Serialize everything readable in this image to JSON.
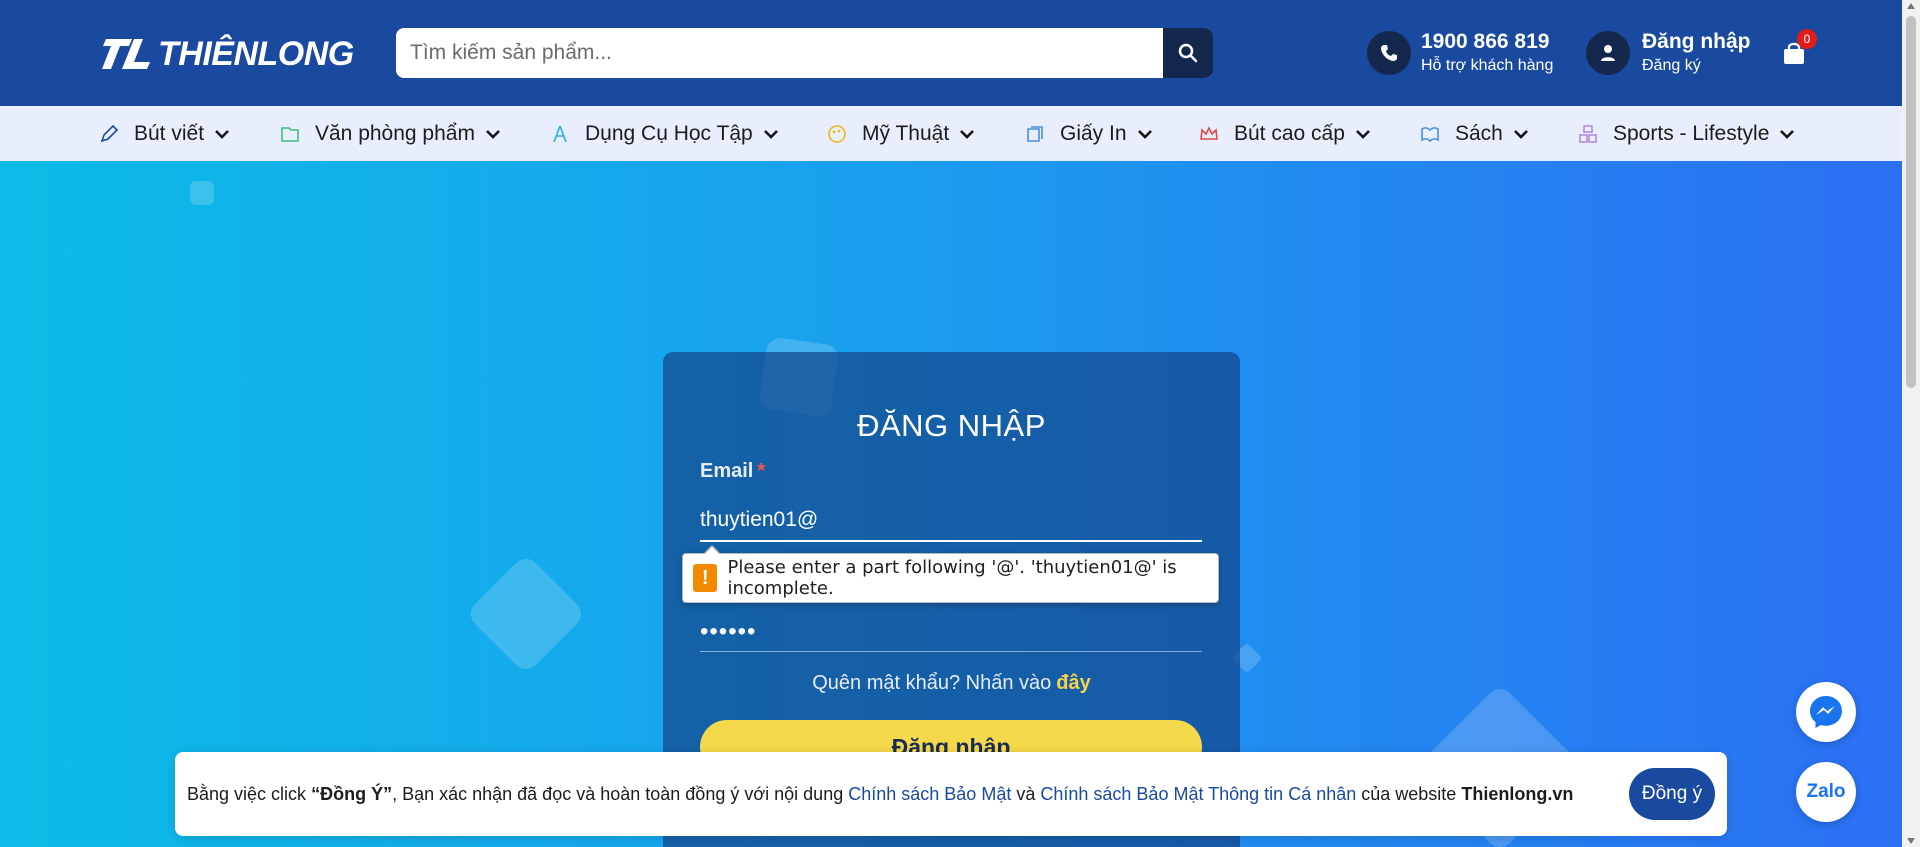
{
  "brand": {
    "logo_text": "THIÊNLONG"
  },
  "search": {
    "placeholder": "Tìm kiếm sản phẩm..."
  },
  "hotline": {
    "number": "1900 866 819",
    "label": "Hỗ trợ khách hàng"
  },
  "account": {
    "login": "Đăng nhập",
    "register": "Đăng ký"
  },
  "cart": {
    "count": "0"
  },
  "nav": [
    {
      "label": "Bút viết",
      "icon": "pen-icon"
    },
    {
      "label": "Văn phòng phẩm",
      "icon": "folder-icon"
    },
    {
      "label": "Dụng Cụ Học Tập",
      "icon": "compass-icon"
    },
    {
      "label": "Mỹ Thuật",
      "icon": "palette-icon"
    },
    {
      "label": "Giấy In",
      "icon": "paper-icon"
    },
    {
      "label": "Bút cao cấp",
      "icon": "crown-icon"
    },
    {
      "label": "Sách",
      "icon": "book-icon"
    },
    {
      "label": "Sports - Lifestyle",
      "icon": "sports-icon"
    }
  ],
  "login": {
    "title": "ĐĂNG NHẬP",
    "email_label": "Email",
    "email_required": "*",
    "email_value": "thuytien01@",
    "password_value": "••••••",
    "forgot_text": "Quên mật khẩu? Nhấn vào",
    "forgot_link": "đây",
    "submit": "Đăng nhập"
  },
  "validation": {
    "message": "Please enter a part following '@'. 'thuytien01@' is incomplete."
  },
  "cookie": {
    "prefix": "Bằng việc click",
    "agree_quote": "“Đồng Ý”",
    "middle": ", Bạn xác nhận đã đọc và hoàn toàn đồng ý với nội dung",
    "link1": "Chính sách Bảo Mật",
    "and": "và",
    "link2": "Chính sách Bảo Mật Thông tin Cá nhân",
    "suffix": "của website",
    "site": "Thienlong.vn",
    "button": "Đồng ý"
  },
  "floating": {
    "zalo": "Zalo"
  },
  "colors": {
    "header": "#1a4aa0",
    "nav_bg": "#e8eefb",
    "accent": "#f5d94a",
    "dark": "#14284d"
  }
}
